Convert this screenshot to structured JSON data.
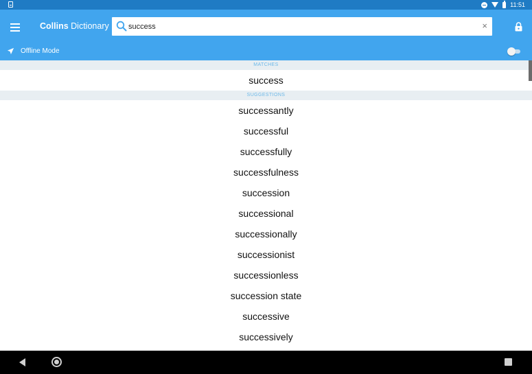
{
  "status_bar": {
    "time": "11:51"
  },
  "app": {
    "brand_bold": "Collins",
    "brand_rest": "Dictionary",
    "search_value": "success",
    "clear_symbol": "×",
    "offline_label": "Offline Mode",
    "offline_enabled": false,
    "icons": {
      "menu": "hamburger-icon",
      "search": "search-icon",
      "clear": "close-icon",
      "lock": "lock-icon",
      "offline": "airplane-icon"
    }
  },
  "matches": {
    "header": "MATCHES",
    "items": [
      "success"
    ]
  },
  "suggestions": {
    "header": "SUGGESTIONS",
    "items": [
      "successantly",
      "successful",
      "successfully",
      "successfulness",
      "succession",
      "successional",
      "successionally",
      "successionist",
      "successionless",
      "succession state",
      "successive",
      "successively"
    ]
  },
  "colors": {
    "status_bar": "#1f7bc4",
    "app_bar": "#41a5ee",
    "section_header_text": "#6bb8e8",
    "section_header_bg": "#e8eef2"
  }
}
